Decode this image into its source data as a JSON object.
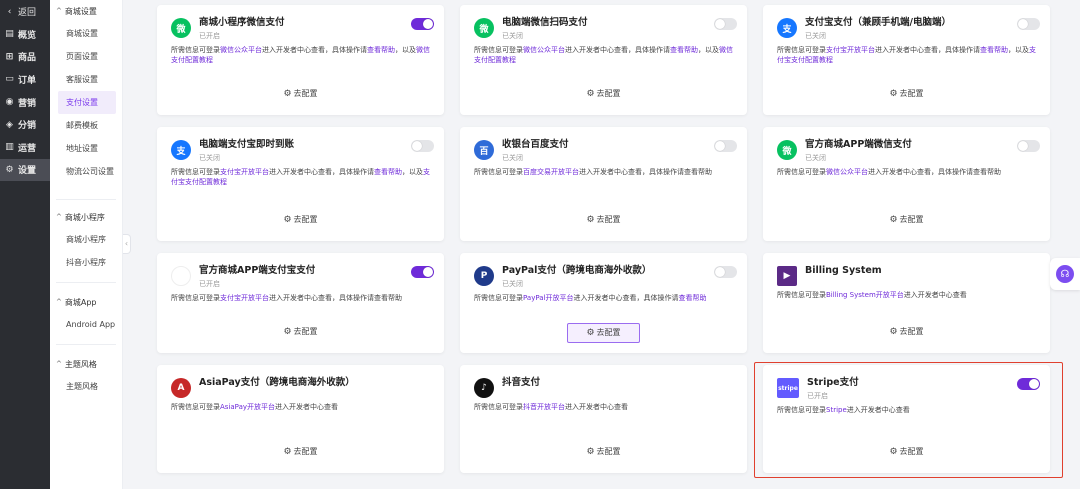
{
  "nav": {
    "back": "返回",
    "items": [
      {
        "label": "概览",
        "icon": "overview-icon",
        "glyph": "▤"
      },
      {
        "label": "商品",
        "icon": "goods-icon",
        "glyph": "⊞"
      },
      {
        "label": "订单",
        "icon": "order-icon",
        "glyph": "▭"
      },
      {
        "label": "营销",
        "icon": "marketing-icon",
        "glyph": "◉"
      },
      {
        "label": "分销",
        "icon": "distribution-icon",
        "glyph": "◈"
      },
      {
        "label": "运营",
        "icon": "operation-icon",
        "glyph": "▥"
      },
      {
        "label": "设置",
        "icon": "settings-icon",
        "glyph": "⚙"
      }
    ]
  },
  "subnav": {
    "groups": [
      {
        "title": "商城设置",
        "items": [
          "商城设置",
          "页面设置",
          "客服设置",
          "支付设置",
          "邮费模板",
          "地址设置",
          "物流公司设置"
        ]
      },
      {
        "title": "商城小程序",
        "items": [
          "商城小程序",
          "抖音小程序"
        ]
      },
      {
        "title": "商城App",
        "items": [
          "Android App"
        ]
      },
      {
        "title": "主题风格",
        "items": [
          "主题风格"
        ]
      }
    ]
  },
  "config_label": "去配置",
  "cards": [
    {
      "title": "商城小程序微信支付",
      "status": "已开启",
      "on": true,
      "logo_text": "微",
      "logo_color": "#07c160",
      "desc": [
        "所需信息可登录",
        {
          "link": "微信公众平台"
        },
        "进入开发者中心查看，具体操作请",
        {
          "link": "查看帮助"
        },
        "，以及",
        {
          "link": "微信支付配置教程"
        }
      ]
    },
    {
      "title": "电脑端微信扫码支付",
      "status": "已关闭",
      "on": false,
      "logo_text": "微",
      "logo_color": "#07c160",
      "desc": [
        "所需信息可登录",
        {
          "link": "微信公众平台"
        },
        "进入开发者中心查看，具体操作请",
        {
          "link": "查看帮助"
        },
        "，以及",
        {
          "link": "微信支付配置教程"
        }
      ]
    },
    {
      "title": "支付宝支付（兼顾手机端/电脑端）",
      "status": "已关闭",
      "on": false,
      "logo_text": "支",
      "logo_color": "#1677ff",
      "desc": [
        "所需信息可登录",
        {
          "link": "支付宝开放平台"
        },
        "进入开发者中心查看，具体操作请",
        {
          "link": "查看帮助"
        },
        "，以及",
        {
          "link": "支付宝支付配置教程"
        }
      ]
    },
    {
      "title": "电脑端支付宝即时到账",
      "status": "已关闭",
      "on": false,
      "logo_text": "支",
      "logo_color": "#1677ff",
      "desc": [
        "所需信息可登录",
        {
          "link": "支付宝开放平台"
        },
        "进入开发者中心查看，具体操作请",
        {
          "link": "查看帮助"
        },
        "，以及",
        {
          "link": "支付宝支付配置教程"
        }
      ]
    },
    {
      "title": "收银台百度支付",
      "status": "已关闭",
      "on": false,
      "logo_text": "百",
      "logo_color": "#2f6bd8",
      "desc": [
        "所需信息可登录",
        {
          "link": "百度交易开放平台"
        },
        "进入开发者中心查看，具体操作请查看帮助"
      ]
    },
    {
      "title": "官方商城APP端微信支付",
      "status": "已关闭",
      "on": false,
      "logo_text": "微",
      "logo_color": "#07c160",
      "desc": [
        "所需信息可登录",
        {
          "link": "微信公众平台"
        },
        "进入开发者中心查看，具体操作请查看帮助"
      ]
    },
    {
      "title": "官方商城APP端支付宝支付",
      "status": "已开启",
      "on": true,
      "logo_text": "",
      "logo_color": "#ffffff",
      "desc": [
        "所需信息可登录",
        {
          "link": "支付宝开放平台"
        },
        "进入开发者中心查看，具体操作请查看帮助"
      ]
    },
    {
      "title": "PayPal支付（跨境电商海外收款）",
      "status": "已关闭",
      "on": false,
      "logo_text": "P",
      "logo_color": "#1f3a8a",
      "desc": [
        "所需信息可登录",
        {
          "link": "PayPal开放平台"
        },
        "进入开发者中心查看，具体操作请",
        {
          "link": "查看帮助"
        }
      ]
    },
    {
      "title": "Billing System",
      "status": "",
      "on": null,
      "logo_text": "▶",
      "logo_color": "#5b2a86",
      "desc": [
        "所需信息可登录",
        {
          "link": "Billing System开放平台"
        },
        "进入开发者中心查看"
      ]
    },
    {
      "title": "AsiaPay支付（跨境电商海外收款）",
      "status": "",
      "on": null,
      "logo_text": "A",
      "logo_color": "#c62828",
      "desc": [
        "所需信息可登录",
        {
          "link": "AsiaPay开放平台"
        },
        "进入开发者中心查看"
      ]
    },
    {
      "title": "抖音支付",
      "status": "",
      "on": null,
      "logo_text": "♪",
      "logo_color": "#111111",
      "desc": [
        "所需信息可登录",
        {
          "link": "抖音开放平台"
        },
        "进入开发者中心查看"
      ]
    },
    {
      "title": "Stripe支付",
      "status": "已开启",
      "on": true,
      "logo_text": "stripe",
      "logo_color": "#635bff",
      "desc": [
        "所需信息可登录",
        {
          "link": "Stripe"
        },
        "进入开发者中心查看"
      ]
    }
  ],
  "colors": {
    "accent": "#6f2bd9",
    "highlight": "#e0402f",
    "nav_bg": "#2b2d32"
  }
}
